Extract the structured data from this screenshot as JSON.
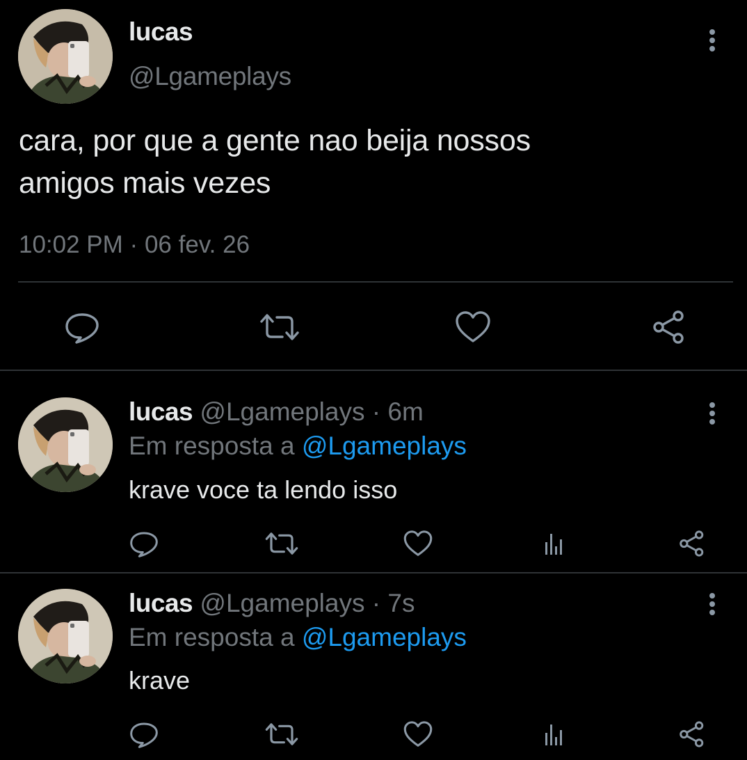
{
  "main_tweet": {
    "author_name": "lucas",
    "author_handle": "@Lgameplays",
    "text_line1": "cara, por que a gente nao beija nossos",
    "text_line2": "amigos mais vezes",
    "time": "10:02 PM",
    "separator": "·",
    "date": "06 fev. 26"
  },
  "replies": [
    {
      "author_name": "lucas",
      "author_handle": "@Lgameplays",
      "separator": "·",
      "age": "6m",
      "in_reply_prefix": "Em resposta a",
      "in_reply_handle": "@Lgameplays",
      "text": "krave voce ta lendo isso"
    },
    {
      "author_name": "lucas",
      "author_handle": "@Lgameplays",
      "separator": "·",
      "age": "7s",
      "in_reply_prefix": "Em resposta a",
      "in_reply_handle": "@Lgameplays",
      "text": "krave"
    }
  ],
  "icons": {
    "reply": "reply-icon",
    "retweet": "retweet-icon",
    "like": "heart-icon",
    "views": "analytics-icon",
    "share": "share-icon",
    "more": "more-vertical-icon"
  },
  "colors": {
    "background": "#000000",
    "text_primary": "#e7e9ea",
    "text_secondary": "#71767b",
    "accent": "#1d9bf0",
    "divider": "#2f3336",
    "icon": "#8b98a5"
  }
}
